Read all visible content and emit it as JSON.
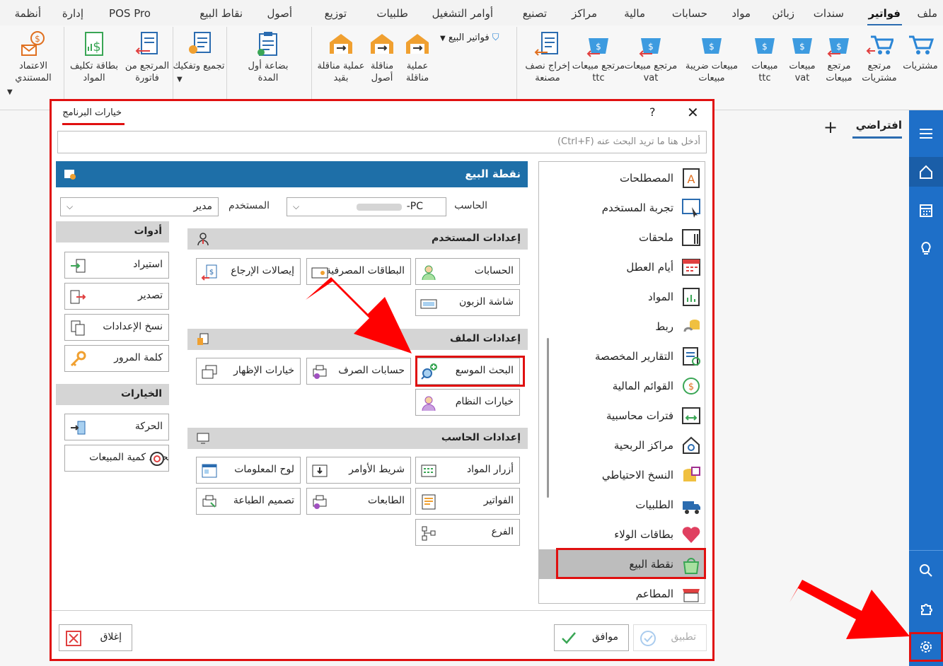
{
  "menubar": {
    "items": [
      "ملف",
      "فواتير",
      "سندات",
      "زبائن",
      "مواد",
      "حسابات",
      "مالية",
      "مراكز",
      "تصنيع",
      "أوامر التشغيل",
      "طلبيات",
      "توزيع",
      "أصول",
      "نقاط البيع",
      "POS Pro",
      "إدارة",
      "أنظمة"
    ],
    "active": "فواتير"
  },
  "ribbon": {
    "purchases": "مشتريات",
    "purchase_return": "مرتجع مشتريات",
    "sales_return": "مرتجع مبيعات",
    "sales_vat": "مبيعات vat",
    "sales_ttc": "مبيعات ttc",
    "sales_tax": "مبيعات ضريبة مبيعات",
    "return_vat": "مرتجع مبيعات vat",
    "return_ttc": "مرتجع مبيعات ttc",
    "semi_out": "إخراج نصف مصنعة",
    "sales_invoices": "فواتير البيع",
    "transfer_op": "عملية مناقلة",
    "asset_transfer": "مناقلة أصول",
    "transfer_entry": "عملية مناقلة بقيد",
    "opening_stock": "بضاعة أول المدة",
    "assemble": "تجميع وتفكيك",
    "invoice_return": "المرتجع من فاتورة",
    "cost_card": "بطاقة تكليف المواد",
    "doc_approval": "الاعتماد المستندي"
  },
  "tabs": {
    "default": "افتراضي",
    "plus": "+"
  },
  "dialog": {
    "title": "خيارات البرنامج",
    "help": "?",
    "close": "✕",
    "search_placeholder": "أدخل هنا ما تريد البحث عنه (Ctrl+F)",
    "header": "نقطة البيع",
    "computer_label": "الحاسب",
    "computer_value": "PC-",
    "user_label": "المستخدم",
    "user_value": "مدير",
    "nav": [
      "المصطلحات",
      "تجربة المستخدم",
      "ملحقات",
      "أيام العطل",
      "المواد",
      "ربط",
      "التقارير المخصصة",
      "القوائم المالية",
      "فترات محاسبية",
      "مراكز الربحية",
      "النسخ الاحتياطي",
      "الطلبيات",
      "بطاقات الولاء",
      "نقطة البيع",
      "المطاعم"
    ],
    "sec_user": "إعدادات المستخدم",
    "sec_file": "إعدادات الملف",
    "sec_pc": "إعدادات الحاسب",
    "sec_tools": "أدوات",
    "sec_options": "الخيارات",
    "b_accounts": "الحسابات",
    "b_cards": "البطاقات المصرفية",
    "b_return_receipts": "إيصالات الإرجاع",
    "b_customer_screen": "شاشة الزبون",
    "b_ext_search": "البحث الموسع",
    "b_exchange": "حسابات الصرف",
    "b_display": "خيارات الإظهار",
    "b_system": "خيارات النظام",
    "b_mat_buttons": "أزرار المواد",
    "b_cmd_bar": "شريط الأوامر",
    "b_info_panel": "لوح المعلومات",
    "b_invoices": "الفواتير",
    "b_printers": "الطابعات",
    "b_print_design": "تصميم الطباعة",
    "b_branch": "الفرع",
    "t_import": "استيراد",
    "t_export": "تصدير",
    "t_copy": "نسخ الإعدادات",
    "t_password": "كلمة المرور",
    "o_motion": "الحركة",
    "o_sales_qty": "تحديد كمية المبيعات",
    "apply": "تطبيق",
    "ok": "موافق",
    "close_btn": "إغلاق"
  },
  "colors": {
    "accent": "#1e6fc8",
    "highlight": "#e01010",
    "header": "#1e6fa8"
  }
}
